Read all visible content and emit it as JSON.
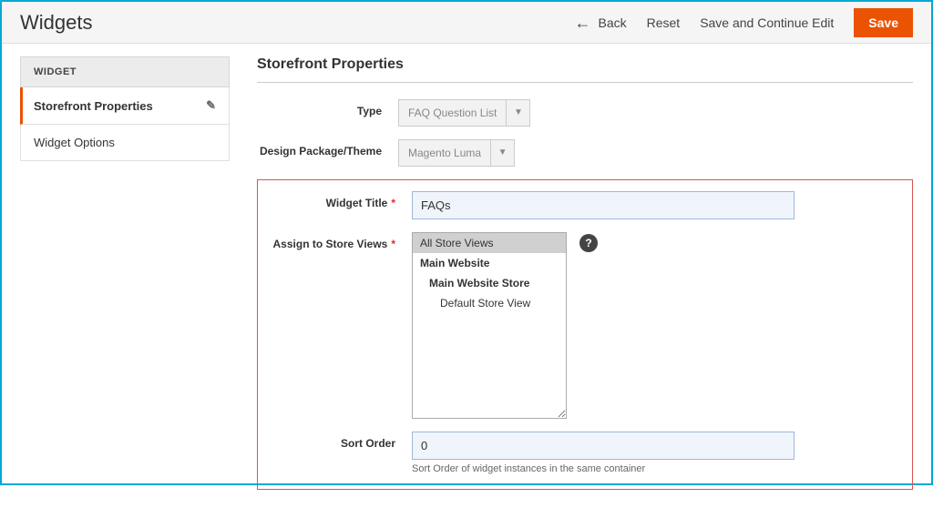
{
  "header": {
    "title": "Widgets",
    "back": "Back",
    "reset": "Reset",
    "saveContinue": "Save and Continue Edit",
    "save": "Save"
  },
  "sidebar": {
    "heading": "WIDGET",
    "items": [
      {
        "label": "Storefront Properties",
        "active": true,
        "editable": true
      },
      {
        "label": "Widget Options",
        "active": false,
        "editable": false
      }
    ]
  },
  "section": {
    "title": "Storefront Properties",
    "type": {
      "label": "Type",
      "value": "FAQ Question List"
    },
    "theme": {
      "label": "Design Package/Theme",
      "value": "Magento Luma"
    },
    "widgetTitle": {
      "label": "Widget Title",
      "value": "FAQs"
    },
    "storeViews": {
      "label": "Assign to Store Views",
      "options": [
        {
          "label": "All Store Views",
          "selected": true,
          "bold": false,
          "indent": 0
        },
        {
          "label": "Main Website",
          "selected": false,
          "bold": true,
          "indent": 0
        },
        {
          "label": "Main Website Store",
          "selected": false,
          "bold": true,
          "indent": 1
        },
        {
          "label": "Default Store View",
          "selected": false,
          "bold": false,
          "indent": 2
        }
      ],
      "tooltip": "?"
    },
    "sortOrder": {
      "label": "Sort Order",
      "value": "0",
      "helper": "Sort Order of widget instances in the same container"
    }
  }
}
